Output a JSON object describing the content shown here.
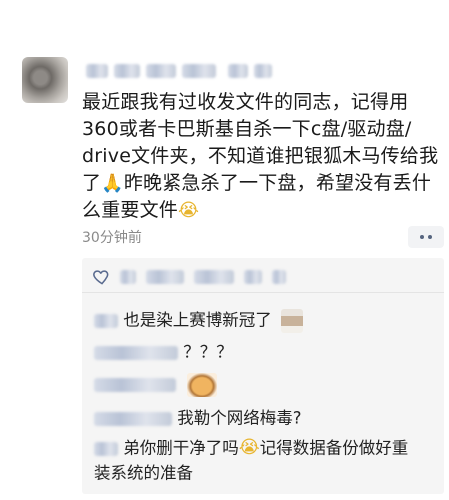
{
  "post": {
    "text_line1": "最近跟我有过收发文件的同志，记得用",
    "text_line2": "360或者卡巴斯基自杀一下c盘/驱动盘/",
    "text_line3": "drive文件夹，不知道谁把银狐木马传给我",
    "text_line4a": "了",
    "emoji_pray": "🙏",
    "text_line4b": "昨晚紧急杀了一下盘，希望没有丢什",
    "text_line5": "么重要文件",
    "emoji_cry": "😭",
    "time": "30分钟前"
  },
  "comments": [
    {
      "text": "也是染上赛博新冠了"
    },
    {
      "text": "？？？"
    },
    {
      "text": ""
    },
    {
      "text": "我勒个网络梅毒?"
    },
    {
      "text_a": "弟你删干净了吗",
      "emoji": "😭",
      "text_b": "记得数据备份做好重",
      "text_c": "装系统的准备"
    }
  ],
  "colors": {
    "link": "#5a6b8f",
    "muted": "#8a8a8a",
    "panel": "#f5f5f5"
  },
  "icons": {
    "like": "heart-icon",
    "more": "more-dots-icon"
  }
}
